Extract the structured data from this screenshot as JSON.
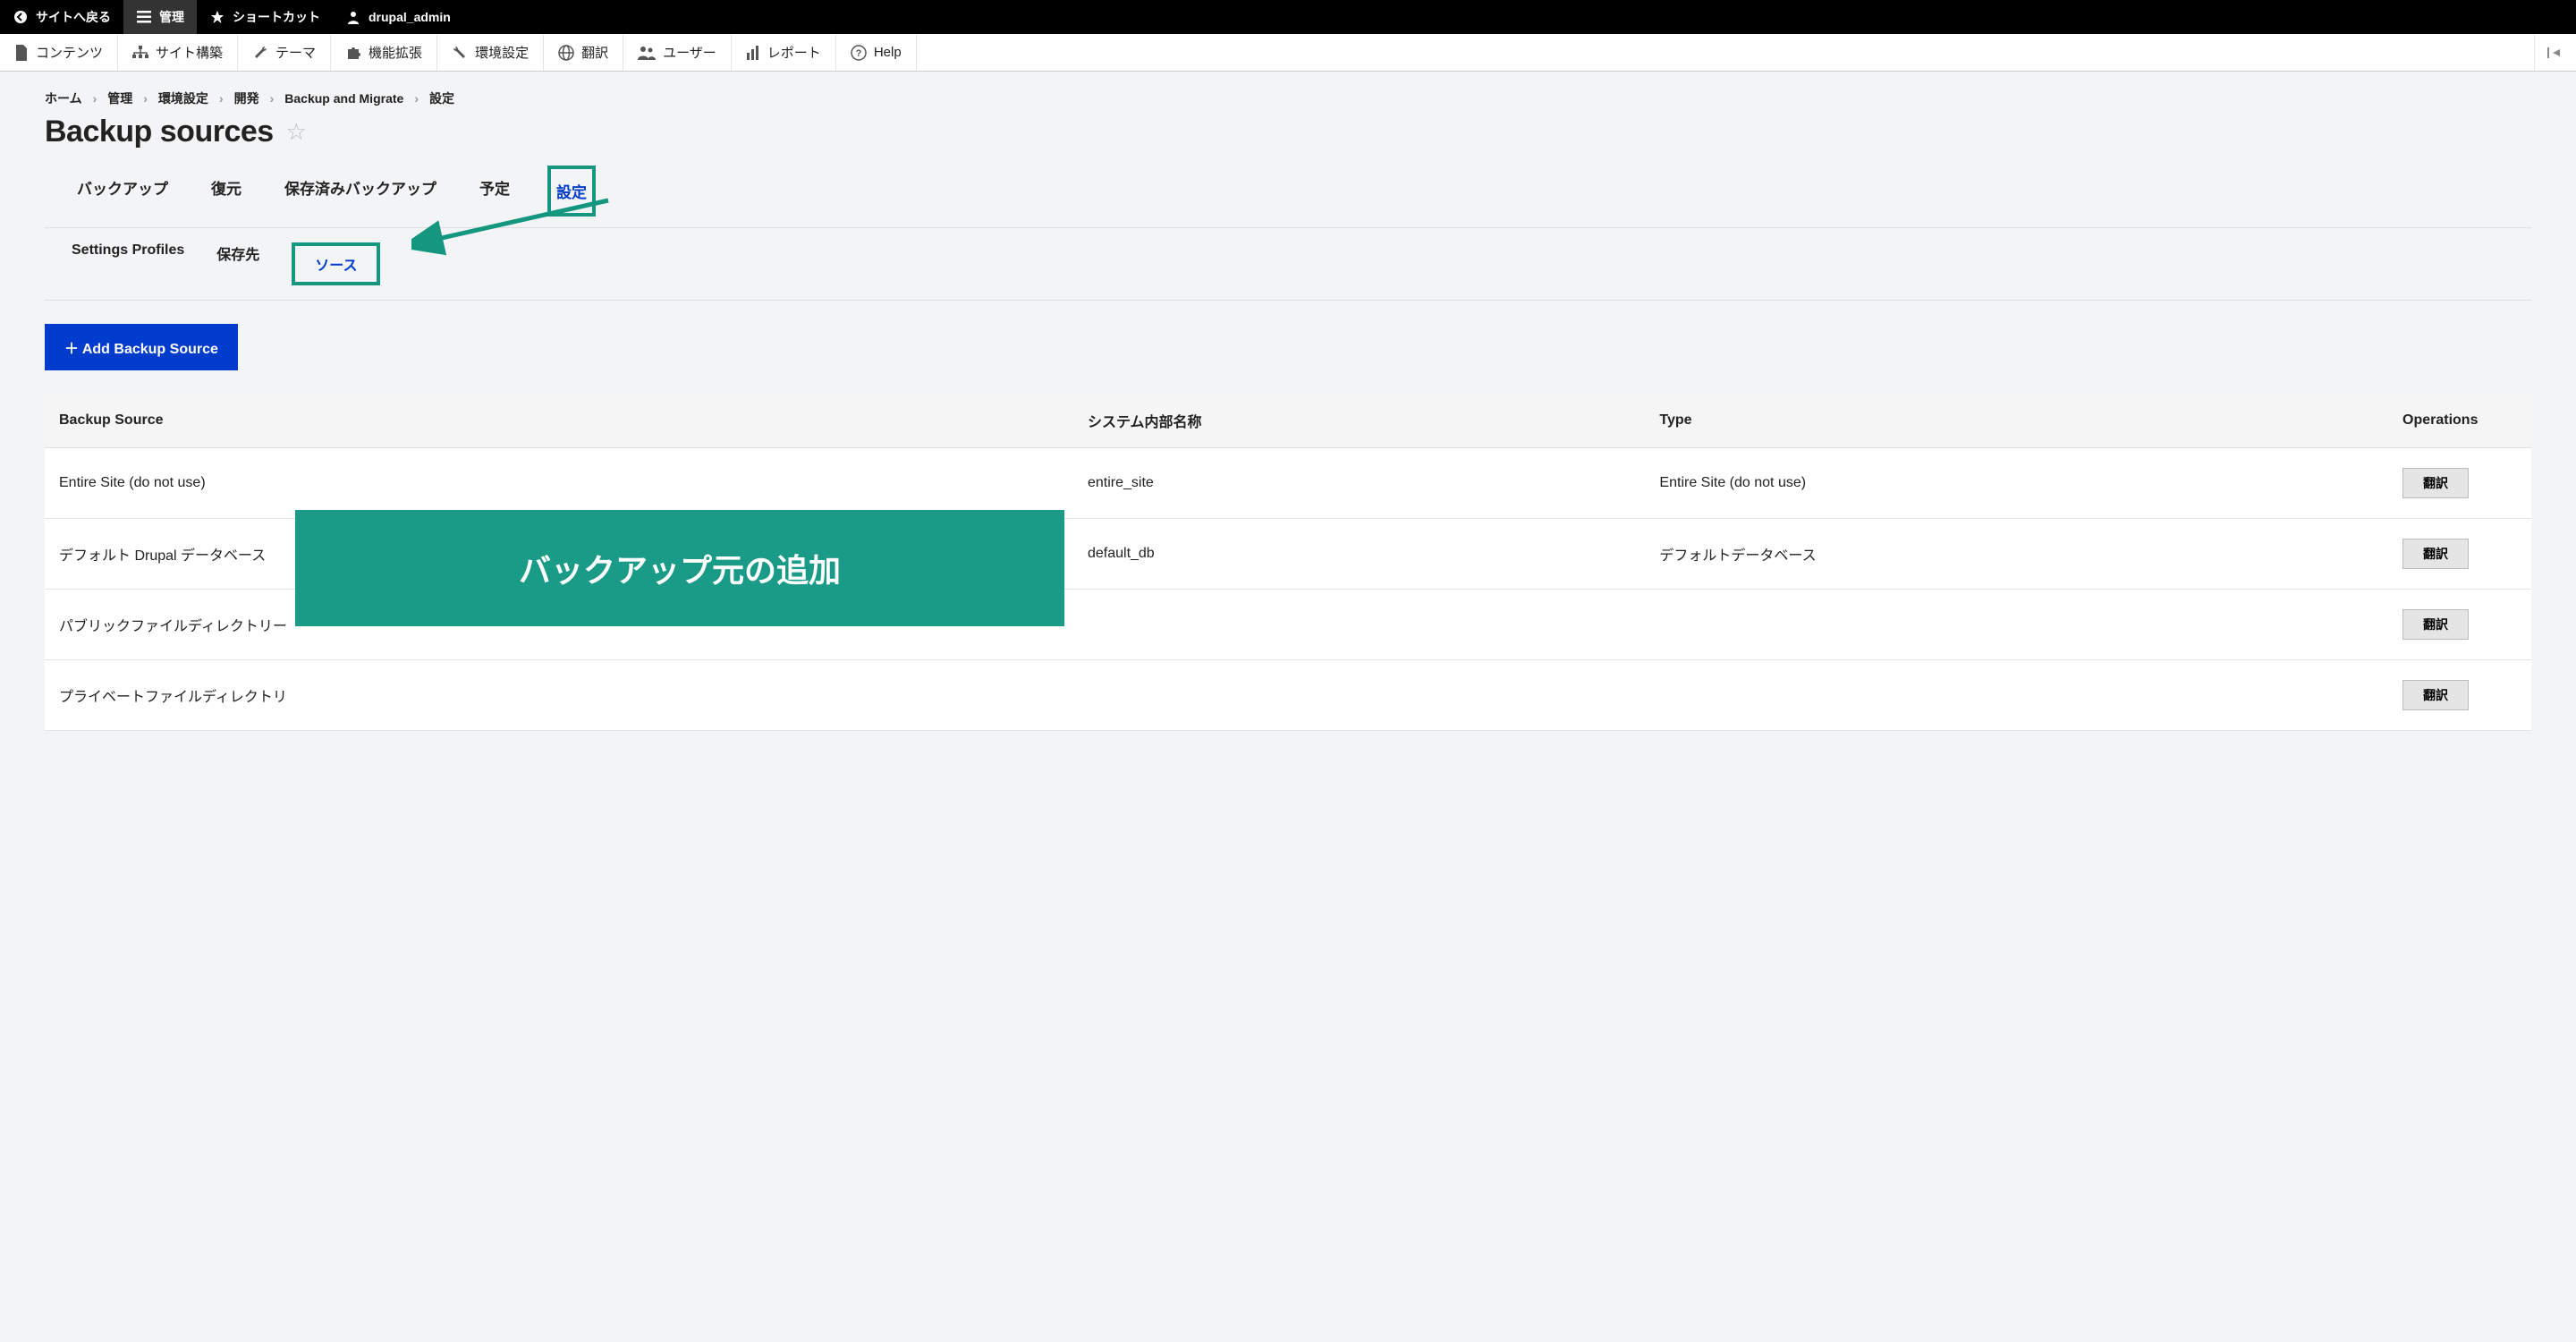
{
  "toolbar_top": {
    "back": "サイトへ戻る",
    "manage": "管理",
    "shortcuts": "ショートカット",
    "user": "drupal_admin"
  },
  "toolbar_admin": {
    "content": "コンテンツ",
    "structure": "サイト構築",
    "appearance": "テーマ",
    "extend": "機能拡張",
    "config": "環境設定",
    "translate": "翻訳",
    "people": "ユーザー",
    "reports": "レポート",
    "help": "Help"
  },
  "breadcrumb": {
    "items": [
      "ホーム",
      "管理",
      "環境設定",
      "開発",
      "Backup and Migrate",
      "設定"
    ]
  },
  "page_title": "Backup sources",
  "tabs_primary": {
    "items": [
      {
        "label": "バックアップ",
        "active": false
      },
      {
        "label": "復元",
        "active": false
      },
      {
        "label": "保存済みバックアップ",
        "active": false
      },
      {
        "label": "予定",
        "active": false
      },
      {
        "label": "設定",
        "active": true,
        "highlight": true
      }
    ]
  },
  "tabs_secondary": {
    "items": [
      {
        "label": "Settings Profiles",
        "active": false
      },
      {
        "label": "保存先",
        "active": false
      },
      {
        "label": "ソース",
        "active": true,
        "highlight": true
      }
    ]
  },
  "add_button": "＋ Add Backup Source",
  "table": {
    "headers": [
      "Backup Source",
      "システム内部名称",
      "Type",
      "Operations"
    ],
    "rows": [
      {
        "name": "Entire Site (do not use)",
        "machine": "entire_site",
        "type": "Entire Site (do not use)",
        "op": "翻訳"
      },
      {
        "name": "デフォルト Drupal データベース",
        "machine": "default_db",
        "type": "デフォルトデータベース",
        "op": "翻訳"
      },
      {
        "name": "パブリックファイルディレクトリー",
        "machine": "",
        "type": "",
        "op": "翻訳"
      },
      {
        "name": "プライベートファイルディレクトリ",
        "machine": "",
        "type": "",
        "op": "翻訳"
      }
    ]
  },
  "annotation_banner": "バックアップ元の追加",
  "colors": {
    "accent": "#14967f",
    "primary": "#003ccc"
  }
}
